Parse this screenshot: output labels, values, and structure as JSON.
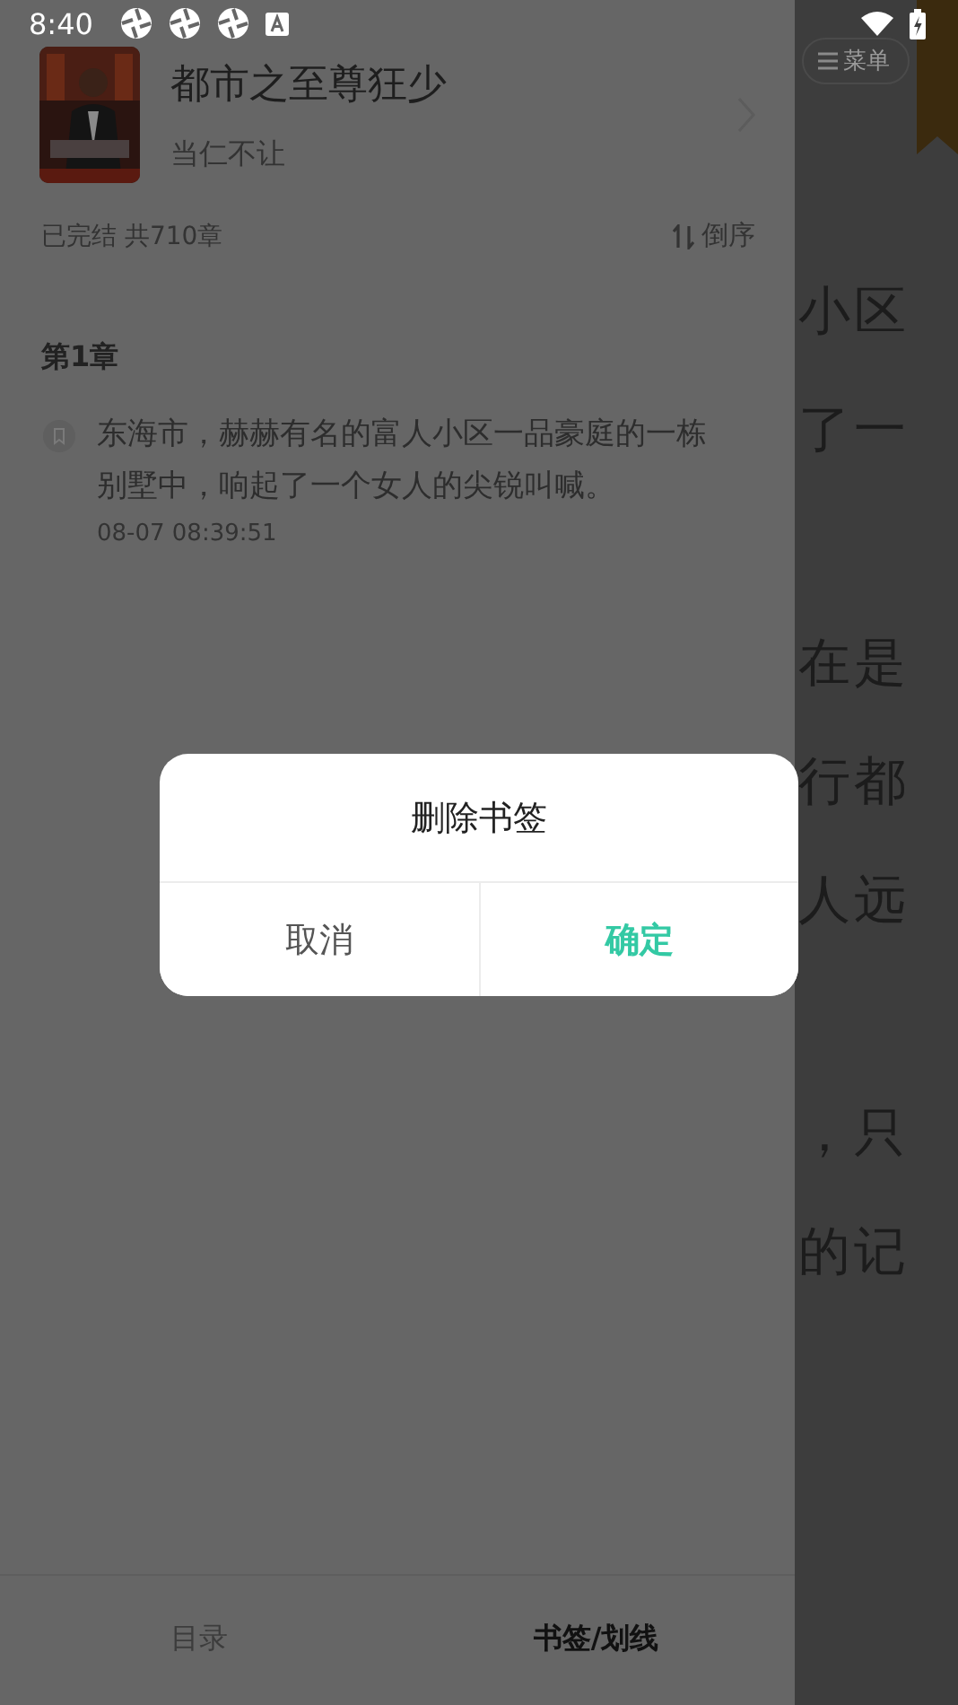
{
  "status_bar": {
    "time": "8:40"
  },
  "book": {
    "title": "都市之至尊狂少",
    "author": "当仁不让"
  },
  "summary": {
    "status": "已完结 共710章",
    "sort": "倒序"
  },
  "bookmarks": [
    {
      "chapter": "第1章",
      "text": "东海市，赫赫有名的富人小区一品豪庭的一栋别墅中，响起了一个女人的尖锐叫喊。",
      "time": "08-07 08:39:51"
    }
  ],
  "bottom_tabs": [
    {
      "label": "目录",
      "selected": false
    },
    {
      "label": "书签/划线",
      "selected": true
    }
  ],
  "reader": {
    "menu_label": "菜单",
    "paragraphs": [
      [
        "小区",
        "了一"
      ],
      [
        "在是",
        "行都",
        "人远"
      ],
      [
        "，只",
        "的记"
      ]
    ]
  },
  "dialog": {
    "title": "删除书签",
    "buttons": [
      {
        "label": "取消",
        "kind": "cancel"
      },
      {
        "label": "确定",
        "kind": "confirm"
      }
    ]
  }
}
